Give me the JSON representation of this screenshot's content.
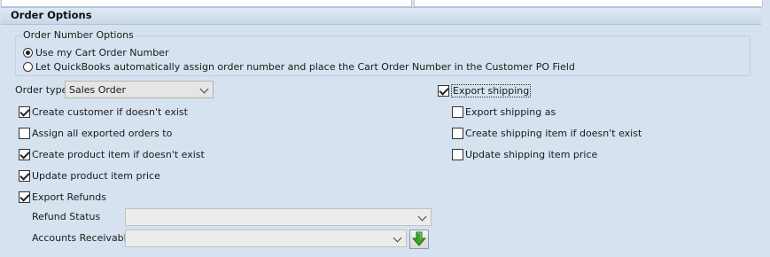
{
  "section": {
    "title": "Order Options"
  },
  "order_number_options": {
    "legend": "Order Number Options",
    "options": [
      {
        "label": "Use my Cart Order Number",
        "selected": true
      },
      {
        "label": "Let QuickBooks automatically assign order number and place the Cart Order Number in the Customer PO Field",
        "selected": false
      }
    ]
  },
  "order_type": {
    "label": "Order type",
    "value": "Sales Order"
  },
  "left_checkboxes": [
    {
      "label": "Create customer if doesn't exist",
      "checked": true
    },
    {
      "label": "Assign all exported orders to",
      "checked": false
    },
    {
      "label": "Create product item if doesn't exist",
      "checked": true
    },
    {
      "label": "Update product item price",
      "checked": true
    },
    {
      "label": "Export Refunds",
      "checked": true
    }
  ],
  "refund_status": {
    "label": "Refund Status",
    "value": ""
  },
  "accounts_receivable": {
    "label": "Accounts Receivable",
    "value": "",
    "action_icon": "download-arrow-icon"
  },
  "right_checkboxes": {
    "export_shipping": {
      "label": "Export shipping",
      "checked": true
    },
    "items": [
      {
        "label": "Export shipping as",
        "checked": false
      },
      {
        "label": "Create shipping item if doesn't exist",
        "checked": false
      },
      {
        "label": "Update shipping item price",
        "checked": false
      }
    ]
  },
  "colors": {
    "background": "#d6e2ef",
    "arrow_green": "#3aa52a"
  }
}
